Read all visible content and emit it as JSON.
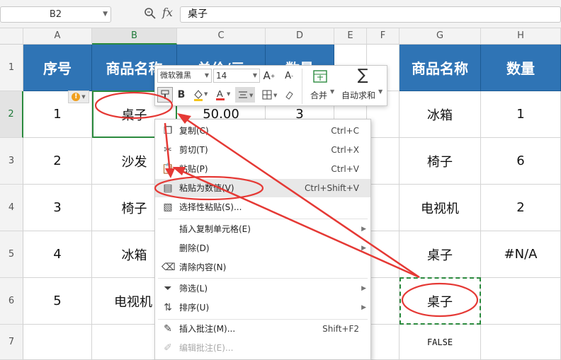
{
  "formula_bar": {
    "cell_ref": "B2",
    "fx": "fx",
    "content": "桌子"
  },
  "columns": [
    "A",
    "B",
    "C",
    "D",
    "E",
    "F",
    "G",
    "H"
  ],
  "rows": [
    "1",
    "2",
    "3",
    "4",
    "5",
    "6",
    "7"
  ],
  "table1": {
    "headers": [
      "序号",
      "商品名称",
      "单价/元",
      "数量"
    ],
    "rows": [
      {
        "no": "1",
        "name": "桌子",
        "price": "50.00",
        "qty": "3"
      },
      {
        "no": "2",
        "name": "沙发"
      },
      {
        "no": "3",
        "name": "椅子"
      },
      {
        "no": "4",
        "name": "冰箱"
      },
      {
        "no": "5",
        "name": "电视机"
      }
    ]
  },
  "table2": {
    "headers": [
      "商品名称",
      "数量"
    ],
    "rows": [
      {
        "name": "冰箱",
        "qty": "1"
      },
      {
        "name": "椅子",
        "qty": "6"
      },
      {
        "name": "电视机",
        "qty": "2"
      },
      {
        "name": "桌子",
        "qty": "#N/A"
      },
      {
        "name": "桌子",
        "qty": ""
      }
    ],
    "g7": "FALSE"
  },
  "mini_toolbar": {
    "font_name": "微软雅黑",
    "font_size": "14",
    "merge_label": "合并",
    "autosum_label": "自动求和",
    "bold": "B",
    "font_color": "A"
  },
  "context_menu": {
    "items": [
      {
        "icon": "copy-icon",
        "label": "复制(C)",
        "shortcut": "Ctrl+C"
      },
      {
        "icon": "scissors-icon",
        "label": "剪切(T)",
        "shortcut": "Ctrl+X"
      },
      {
        "icon": "paste-icon",
        "label": "粘贴(P)",
        "shortcut": "Ctrl+V"
      },
      {
        "icon": "paste-values-icon",
        "label": "粘贴为数值(V)",
        "shortcut": "Ctrl+Shift+V"
      },
      {
        "icon": "paste-special-icon",
        "label": "选择性粘贴(S)...",
        "shortcut": ""
      },
      {
        "icon": "",
        "label": "插入复制单元格(E)",
        "shortcut": ""
      },
      {
        "icon": "",
        "label": "删除(D)",
        "shortcut": ""
      },
      {
        "icon": "eraser-icon",
        "label": "清除内容(N)",
        "shortcut": ""
      },
      {
        "icon": "filter-icon",
        "label": "筛选(L)",
        "shortcut": ""
      },
      {
        "icon": "sort-icon",
        "label": "排序(U)",
        "shortcut": ""
      },
      {
        "icon": "comment-icon",
        "label": "插入批注(M)...",
        "shortcut": "Shift+F2"
      },
      {
        "icon": "edit-comment-icon",
        "label": "编辑批注(E)...",
        "shortcut": ""
      }
    ]
  },
  "colors": {
    "header_blue": "#2f74b5",
    "select_green": "#2b8a3e",
    "annotation_red": "#e53935"
  }
}
